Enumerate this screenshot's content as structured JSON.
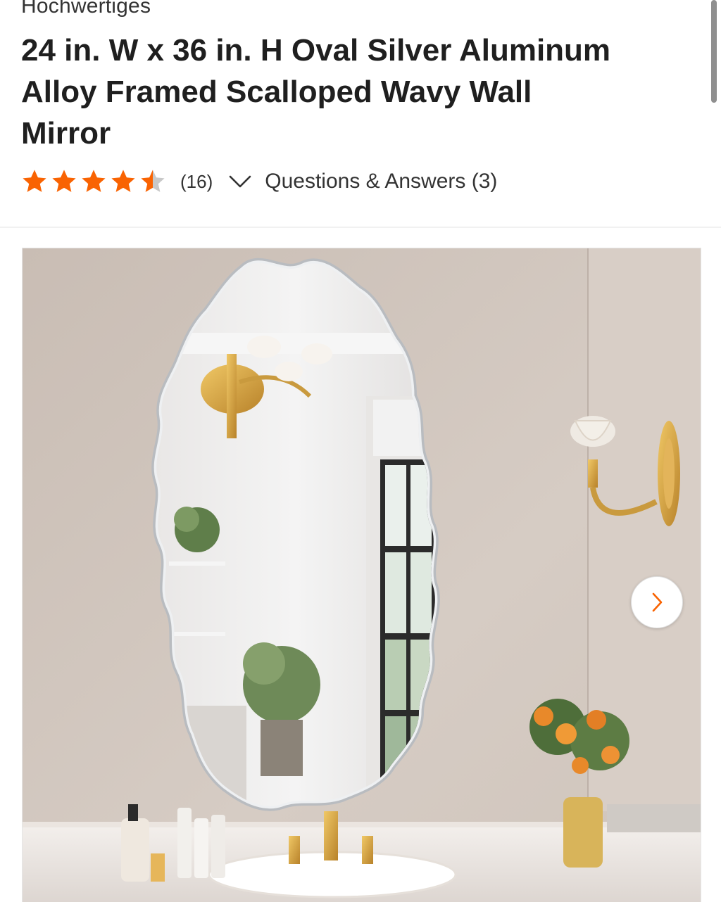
{
  "product": {
    "brand": "Hochwertiges",
    "title": "24 in. W x 36 in. H Oval Silver Aluminum Alloy Framed Scalloped Wavy Wall Mirror",
    "rating": 4.5,
    "rating_max": 5,
    "review_count_label": "(16)",
    "qa_label": "Questions & Answers (3)"
  },
  "colors": {
    "star": "#f96302",
    "star_empty": "#c8c8c8",
    "next_arrow": "#f96302"
  },
  "icons": {
    "stars": "star-icon",
    "expand": "chevron-down-icon",
    "next": "chevron-right-icon"
  }
}
